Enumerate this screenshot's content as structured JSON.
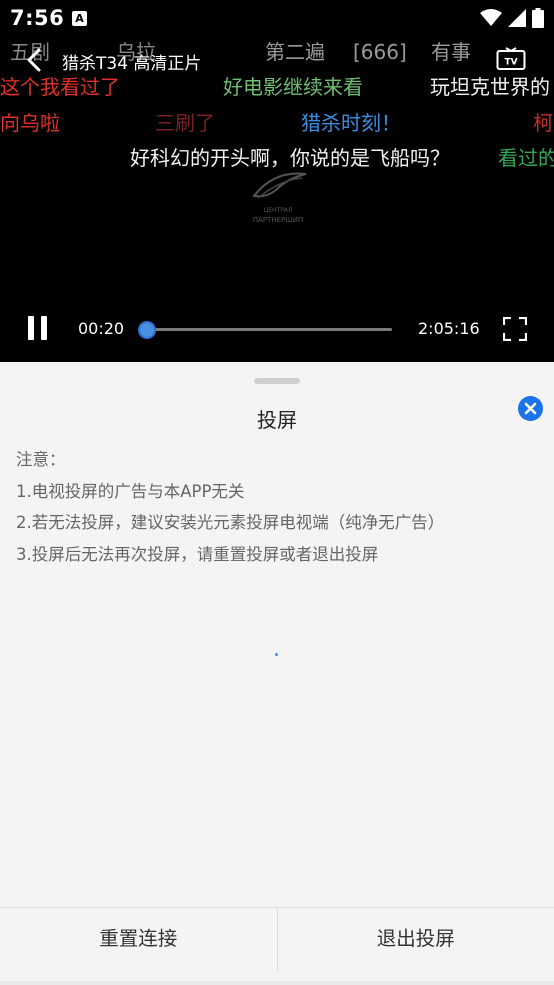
{
  "status": {
    "time": "7:56",
    "app_icon_letter": "A"
  },
  "player": {
    "title": "猎杀T34 高清正片",
    "current_time": "00:20",
    "total_time": "2:05:16",
    "progress": 0.0027,
    "is_playing": true,
    "watermark_text": "ЦЕНТРАЛ ПАРТНЕРШИП"
  },
  "danmaku": [
    {
      "text": "五剧",
      "color": "#8a8a8a"
    },
    {
      "text": "乌拉",
      "color": "#8a8a8a"
    },
    {
      "text": "第二遍",
      "color": "#9a9a9a"
    },
    {
      "text": "[666]",
      "color": "#9a9a9a"
    },
    {
      "text": "有事",
      "color": "#9a9a9a"
    },
    {
      "text": "这个我看过了",
      "color": "#e0302c"
    },
    {
      "text": "好电影继续来看",
      "color": "#6fbf73"
    },
    {
      "text": "玩坦克世界的",
      "color": "#f2f2f2"
    },
    {
      "text": "向乌啦",
      "color": "#e0302c"
    },
    {
      "text": "三刷了",
      "color": "#7a2222"
    },
    {
      "text": "猎杀时刻！",
      "color": "#3b8de0"
    },
    {
      "text": "柯",
      "color": "#c0302c"
    },
    {
      "text": "好科幻的开头啊，你说的是飞船吗？",
      "color": "#f2f2f2"
    },
    {
      "text": "看过的",
      "color": "#34a853"
    }
  ],
  "sheet": {
    "title": "投屏",
    "notes": [
      "注意：",
      "1.电视投屏的广告与本APP无关",
      "2.若无法投屏，建议安装光元素投屏电视端（纯净无广告）",
      "3.投屏后无法再次投屏，请重置投屏或者退出投屏"
    ],
    "reset_label": "重置连接",
    "exit_label": "退出投屏"
  },
  "colors": {
    "accent": "#1a73e8",
    "sheet_bg": "#f4f4f4",
    "player_bg": "#000000"
  }
}
